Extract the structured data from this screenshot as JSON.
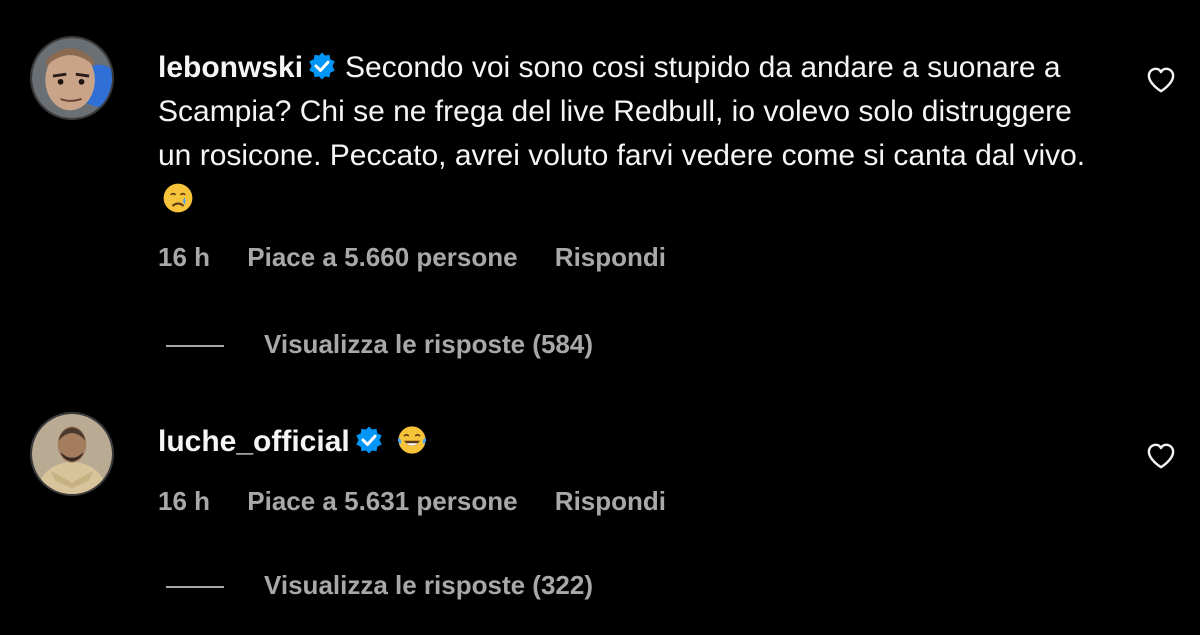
{
  "comments": [
    {
      "username": "lebonwski",
      "verified": true,
      "text": "Secondo voi sono cosi stupido da andare a suonare a Scampia? Chi se ne frega del live Redbull, io volevo solo distruggere un rosicone. Peccato, avrei voluto farvi vedere come si canta dal vivo.",
      "emoji": "crying-face",
      "time": "16 h",
      "likes": "Piace a 5.660 persone",
      "reply": "Rispondi",
      "view_replies": "Visualizza le risposte (584)"
    },
    {
      "username": "luche_official",
      "verified": true,
      "text": "",
      "emoji": "face-with-tears-of-joy",
      "time": "16 h",
      "likes": "Piace a 5.631 persone",
      "reply": "Rispondi",
      "view_replies": "Visualizza le risposte (322)"
    }
  ],
  "colors": {
    "background": "#000000",
    "text": "#f5f5f5",
    "secondary": "#a8a8a8",
    "verified": "#0095f6"
  }
}
